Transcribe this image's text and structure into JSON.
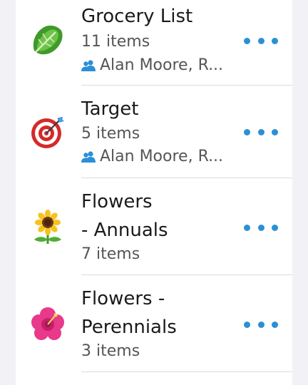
{
  "lists": [
    {
      "title_lines": [
        "Grocery List"
      ],
      "count": "11 items",
      "shared_with": "Alan Moore, R...",
      "icon": "lettuce-icon"
    },
    {
      "title_lines": [
        "Target"
      ],
      "count": "5 items",
      "shared_with": "Alan Moore, R...",
      "icon": "target-icon"
    },
    {
      "title_lines": [
        "Flowers",
        "- Annuals"
      ],
      "count": "7 items",
      "icon": "sunflower-icon"
    },
    {
      "title_lines": [
        "Flowers -",
        "Perennials"
      ],
      "count": "3 items",
      "icon": "hibiscus-icon"
    }
  ],
  "colors": {
    "accent": "#2b8fd6",
    "divider": "#dcdcdc",
    "background": "#f2f2f6"
  }
}
